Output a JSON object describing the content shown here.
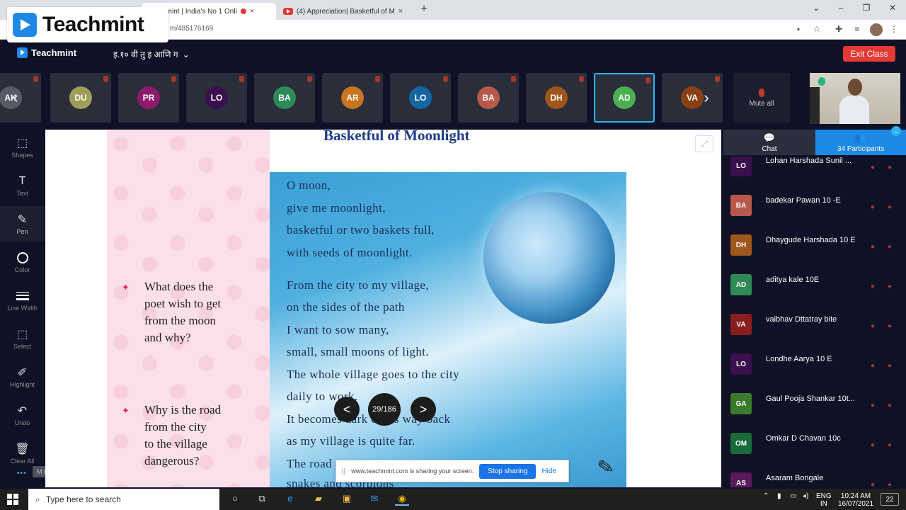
{
  "browser": {
    "tabs": [
      {
        "title": "Teachmint | India's No 1 Onli",
        "active": true
      },
      {
        "title": "(4) Appreciation| Basketful of M",
        "active": false
      }
    ],
    "url": "m/485176169",
    "newtab": "+",
    "close": "×"
  },
  "watermark": {
    "text": "Teachmint"
  },
  "app": {
    "brand": "Teachmint",
    "class_name": "इ.१० वी तु इ आणि ग",
    "exit_label": "Exit Class"
  },
  "participants_strip": {
    "tiles": [
      {
        "initials": "AK",
        "color": "#555a66"
      },
      {
        "initials": "DU",
        "color": "#9e9d5a"
      },
      {
        "initials": "PR",
        "color": "#8e1a6e"
      },
      {
        "initials": "LO",
        "color": "#3a0f4e"
      },
      {
        "initials": "BA",
        "color": "#2e8b57"
      },
      {
        "initials": "AR",
        "color": "#c9741e"
      },
      {
        "initials": "LO",
        "color": "#1565a0"
      },
      {
        "initials": "BA",
        "color": "#b7584a"
      },
      {
        "initials": "DH",
        "color": "#a0561a"
      },
      {
        "initials": "AD",
        "color": "#4caf50",
        "selected": true
      },
      {
        "initials": "VA",
        "color": "#8a3f12"
      }
    ],
    "mute_all": "Mute all"
  },
  "tools": [
    {
      "label": "Shapes",
      "icon": "square-icon"
    },
    {
      "label": "Text",
      "icon": "text-icon"
    },
    {
      "label": "Pen",
      "icon": "pen-icon",
      "active": true
    },
    {
      "label": "Color",
      "icon": "circle-icon"
    },
    {
      "label": "Line Width",
      "icon": "lines-icon"
    },
    {
      "label": "Select",
      "icon": "select-icon"
    },
    {
      "label": "Highlight",
      "icon": "highlight-icon"
    },
    {
      "label": "Undo",
      "icon": "undo-icon"
    },
    {
      "label": "Clear All",
      "icon": "trash-icon"
    }
  ],
  "mkasabe_label": "M Kasabe: Fit",
  "slide": {
    "title": "Basketful of Moonlight",
    "questions": [
      "What does the\npoet wish to get\nfrom the moon\nand why?",
      "Why is the road\nfrom the city\nto the village\ndangerous?"
    ],
    "poem": [
      "O moon,",
      "give me moonlight,",
      "basketful or two baskets full,",
      "with seeds of moonlight.",
      "From the city to my village,",
      "on the sides of the path",
      "I want to sow many,",
      "small, small moons of light.",
      "The whole village goes to the city",
      "daily to work.",
      "It becomes dark on its way back",
      "as my village is quite far.",
      "The road",
      "snakes and scorpions"
    ]
  },
  "slide_nav": {
    "prev": "<",
    "next": ">",
    "page": "29/186"
  },
  "share_bar": {
    "pause": "||",
    "message": "www.teachmint.com is sharing your screen.",
    "stop": "Stop sharing",
    "hide": "Hide"
  },
  "right_panel": {
    "chat_label": "Chat",
    "participants_label": "34 Participants",
    "participants": [
      {
        "initials": "LO",
        "name": "Lohan Harshada Sunil ...",
        "color": "#3a0f4e"
      },
      {
        "initials": "BA",
        "name": "badekar Pawan 10 -E",
        "color": "#b7584a"
      },
      {
        "initials": "DH",
        "name": "Dhaygude Harshada 10 E",
        "color": "#a0561a"
      },
      {
        "initials": "AD",
        "name": "aditya kale 10E",
        "color": "#2e8b57"
      },
      {
        "initials": "VA",
        "name": "vaibhav Dttatray bite",
        "color": "#8a1e1e"
      },
      {
        "initials": "LO",
        "name": "Londhe Aarya 10 E",
        "color": "#3a0f4e"
      },
      {
        "initials": "GA",
        "name": "Gaul Pooja Shankar 10t...",
        "color": "#3a7a2a"
      },
      {
        "initials": "OM",
        "name": "Omkar D Chavan 10c",
        "color": "#1a6a3a"
      },
      {
        "initials": "AS",
        "name": "Asaram Bongale",
        "color": "#5a1a5a"
      }
    ]
  },
  "taskbar": {
    "search_placeholder": "Type here to search",
    "lang_top": "ENG",
    "lang_bottom": "IN",
    "time": "10:24 AM",
    "date": "16/07/2021",
    "notif_count": "22"
  }
}
